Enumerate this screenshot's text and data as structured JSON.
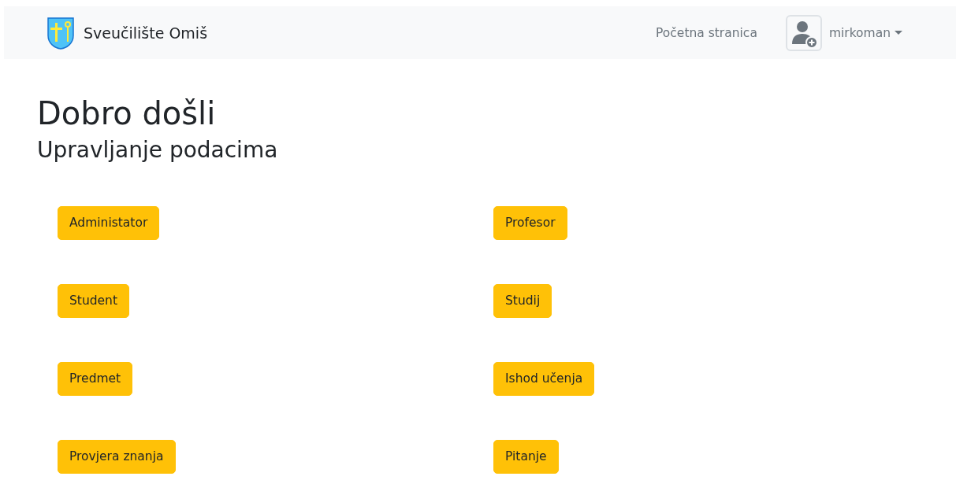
{
  "navbar": {
    "brand": "Sveučilište Omiš",
    "links": [
      {
        "label": "Početna stranica"
      }
    ],
    "user": {
      "name": "mirkoman"
    }
  },
  "heading": "Dobro došli",
  "subheading": "Upravljanje podacima",
  "buttons": [
    {
      "label": "Administator"
    },
    {
      "label": "Profesor"
    },
    {
      "label": "Student"
    },
    {
      "label": "Studij"
    },
    {
      "label": "Predmet"
    },
    {
      "label": "Ishod učenja"
    },
    {
      "label": "Provjera znanja"
    },
    {
      "label": "Pitanje"
    }
  ]
}
